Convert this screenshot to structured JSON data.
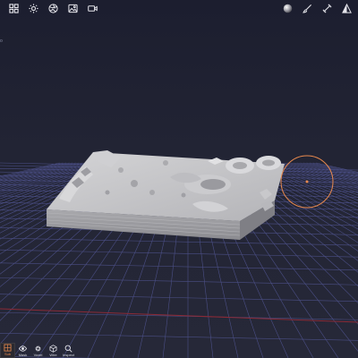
{
  "app": {
    "colors": {
      "background_top": "#1c1e2f",
      "background_bottom": "#262838",
      "grid_line": "#4b4f86",
      "axis_x": "#8a2a36",
      "model": "#c6c6c8",
      "accent_orange": "#e8894e",
      "toolbar_icon": "#e6e6ec"
    }
  },
  "top_toolbar": {
    "left_icons": [
      "grid-icon",
      "sun-icon",
      "aperture-icon",
      "image-icon",
      "video-icon"
    ],
    "right_icons": [
      "material-ball-icon",
      "brush-icon",
      "edit-tool-icon",
      "perspective-icon"
    ]
  },
  "side_label": "ο",
  "bottom_toolbar": {
    "modes": [
      {
        "label": "Sub",
        "icon": "subdivide-icon",
        "active": true
      },
      {
        "label": "Mask",
        "icon": "eye-icon",
        "active": false
      },
      {
        "label": "Voxel",
        "icon": "gear-icon",
        "active": false
      },
      {
        "label": "Wire",
        "icon": "cube-wire-icon",
        "active": false
      },
      {
        "label": "Inspect",
        "icon": "magnifier-icon",
        "active": false
      }
    ]
  }
}
